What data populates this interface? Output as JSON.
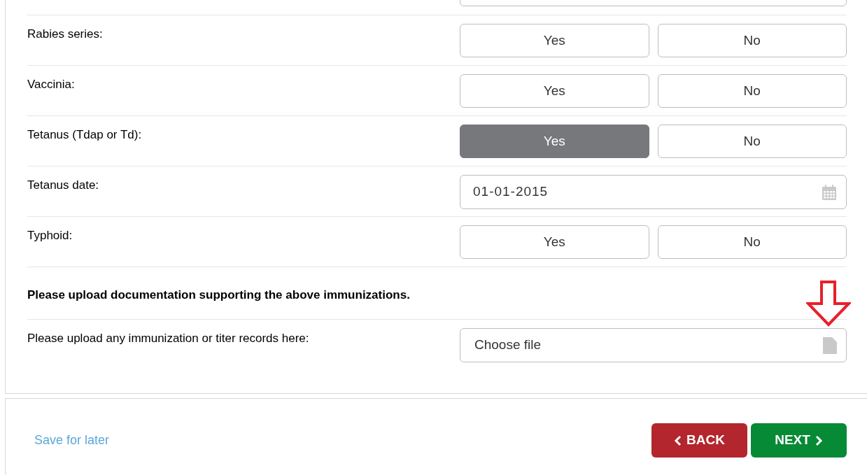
{
  "rows": [
    {
      "kind": "yes_no",
      "label": "Rabies series:",
      "options": [
        {
          "label": "Yes",
          "selected": false
        },
        {
          "label": "No",
          "selected": false
        }
      ]
    },
    {
      "kind": "yes_no",
      "label": "Vaccinia:",
      "options": [
        {
          "label": "Yes",
          "selected": false
        },
        {
          "label": "No",
          "selected": false
        }
      ]
    },
    {
      "kind": "yes_no",
      "label": "Tetanus (Tdap or Td):",
      "options": [
        {
          "label": "Yes",
          "selected": true
        },
        {
          "label": "No",
          "selected": false
        }
      ]
    },
    {
      "kind": "date",
      "label": "Tetanus date:",
      "value": "01-01-2015"
    },
    {
      "kind": "yes_no",
      "label": "Typhoid:",
      "options": [
        {
          "label": "Yes",
          "selected": false
        },
        {
          "label": "No",
          "selected": false
        }
      ]
    },
    {
      "kind": "heading",
      "text": "Please upload documentation supporting the above immunizations."
    },
    {
      "kind": "file",
      "label": "Please upload any immunization or titer records here:",
      "button_text": "Choose file"
    }
  ],
  "footer": {
    "save_link": "Save for later",
    "back_button": "BACK",
    "next_button": "NEXT"
  }
}
